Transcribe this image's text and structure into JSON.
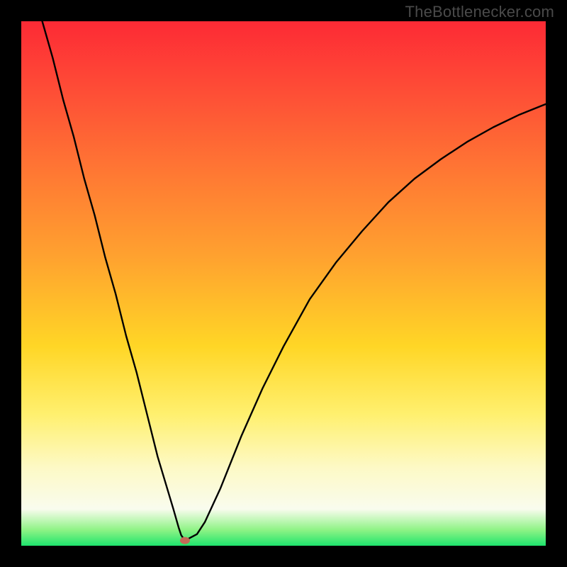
{
  "watermark": "TheBottlenecker.com",
  "chart_data": {
    "type": "line",
    "title": "",
    "xlabel": "",
    "ylabel": "",
    "xlim": [
      0,
      100
    ],
    "ylim": [
      0,
      100
    ],
    "series": [
      {
        "name": "curve",
        "x": [
          4,
          6,
          8,
          10,
          12,
          14,
          16,
          18,
          20,
          22,
          24,
          26,
          27.5,
          29,
          30,
          30.5,
          31,
          31.5,
          32,
          33.5,
          35,
          38,
          42,
          46,
          50,
          55,
          60,
          65,
          70,
          75,
          80,
          85,
          90,
          95,
          100
        ],
        "y": [
          100,
          93,
          85,
          78,
          70,
          63,
          55,
          48,
          40,
          33,
          25,
          17,
          12,
          7,
          3.5,
          2,
          1.3,
          1.1,
          1.4,
          2.2,
          4.5,
          11,
          21,
          30,
          38,
          47,
          54,
          60,
          65.5,
          70,
          73.7,
          77,
          79.8,
          82.2,
          84.2
        ]
      }
    ],
    "marker": {
      "x": 31.2,
      "y": 1.0
    },
    "gradient_stops": [
      {
        "pos": 0.0,
        "color": "#fd2a35"
      },
      {
        "pos": 0.14,
        "color": "#fe4f36"
      },
      {
        "pos": 0.3,
        "color": "#ff7b33"
      },
      {
        "pos": 0.45,
        "color": "#ffa22f"
      },
      {
        "pos": 0.62,
        "color": "#ffd626"
      },
      {
        "pos": 0.75,
        "color": "#fff06f"
      },
      {
        "pos": 0.85,
        "color": "#fdf9c5"
      },
      {
        "pos": 0.93,
        "color": "#f9fcee"
      },
      {
        "pos": 0.97,
        "color": "#8ef385"
      },
      {
        "pos": 1.0,
        "color": "#1ee46d"
      }
    ]
  }
}
